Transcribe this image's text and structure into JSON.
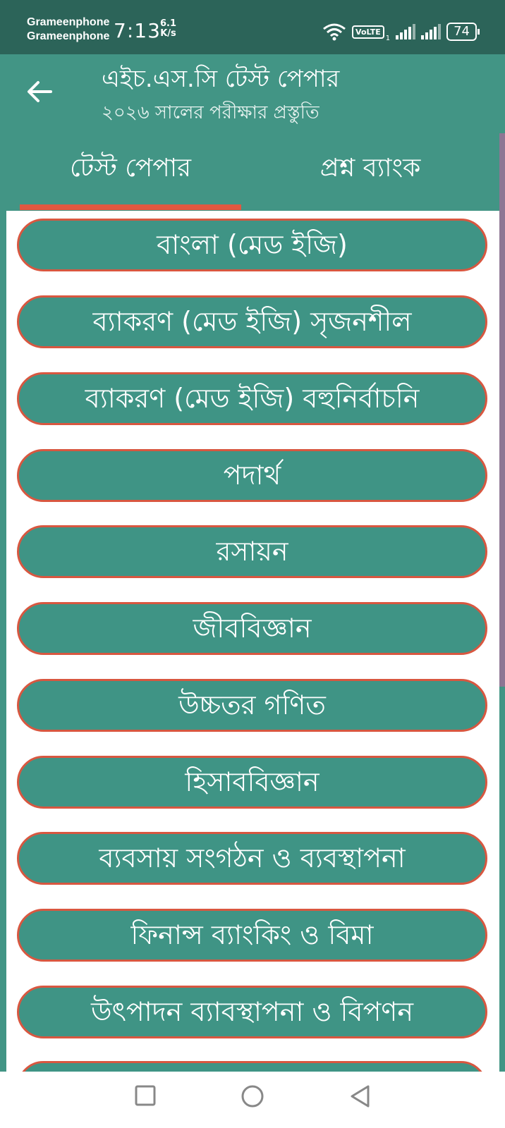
{
  "status_bar": {
    "carrier_1": "Grameenphone",
    "carrier_2": "Grameenphone",
    "time": "7:13",
    "speed_value": "6.1",
    "speed_unit": "K/s",
    "volte": "VoLTE",
    "sim_index": "1",
    "battery": "74"
  },
  "app_bar": {
    "back_icon": "arrow-left-icon",
    "title": "এইচ.এস.সি টেস্ট পেপার",
    "subtitle": "২০২৬ সালের পরীক্ষার প্রস্তুতি"
  },
  "tabs": [
    {
      "label": "টেস্ট পেপার",
      "selected": true
    },
    {
      "label": "প্রশ্ন ব্যাংক",
      "selected": false
    }
  ],
  "subjects": [
    "বাংলা (মেড ইজি)",
    "ব্যাকরণ (মেড ইজি) সৃজনশীল",
    "ব্যাকরণ (মেড ইজি) বহুনির্বাচনি",
    "পদার্থ",
    "রসায়ন",
    "জীববিজ্ঞান",
    "উচ্চতর গণিত",
    "হিসাববিজ্ঞান",
    "ব্যবসায় সংগঠন ও ব্যবস্থাপনা",
    "ফিনান্স ব্যাংকিং ও বিমা",
    "উৎপাদন ব্যাবস্থাপনা ও বিপণন"
  ],
  "colors": {
    "primary": "#429585",
    "status_bar": "#2c6459",
    "accent": "#e05841",
    "button_border": "#d85740",
    "button_fill": "#3f9485"
  },
  "nav_bar": {
    "recents_icon": "square-icon",
    "home_icon": "circle-icon",
    "back_icon": "triangle-back-icon"
  }
}
